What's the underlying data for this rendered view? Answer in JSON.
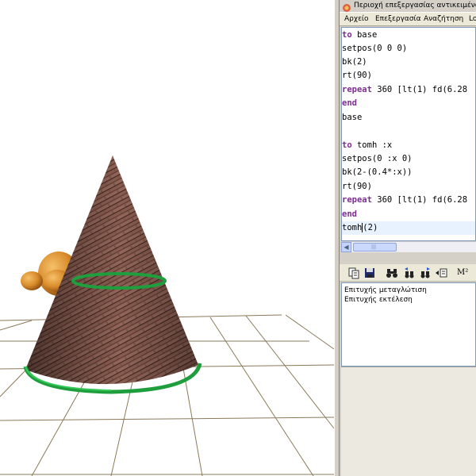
{
  "window": {
    "title": "Περιοχή επεξεργασίας αντικειμένων"
  },
  "menu": {
    "items": [
      {
        "label": "Αρχείο"
      },
      {
        "label": "Επεξεργασία"
      },
      {
        "label": "Αναζήτηση"
      },
      {
        "label": "Lo"
      }
    ]
  },
  "code": {
    "lines": [
      {
        "kw": "to",
        "text": " base"
      },
      {
        "kw": "",
        "text": "setpos(0 0 0)"
      },
      {
        "kw": "",
        "text": "bk(2)"
      },
      {
        "kw": "",
        "text": "rt(90)"
      },
      {
        "kw": "repeat",
        "text": " 360 [lt(1) fd(6.28"
      },
      {
        "kw": "end",
        "text": ""
      },
      {
        "kw": "",
        "text": "base"
      },
      {
        "kw": "",
        "text": ""
      },
      {
        "kw": "to",
        "text": " tomh :x"
      },
      {
        "kw": "",
        "text": "setpos(0 :x 0)"
      },
      {
        "kw": "",
        "text": "bk(2-(0.4*:x))"
      },
      {
        "kw": "",
        "text": "rt(90)"
      },
      {
        "kw": "repeat",
        "text": " 360 [lt(1) fd(6.28"
      },
      {
        "kw": "end",
        "text": ""
      },
      {
        "kw": "",
        "text": "tomh",
        "after_caret": "(2)"
      }
    ]
  },
  "scrollbar": {
    "left_arrow": "◀",
    "grip": "|||"
  },
  "toolbar": {
    "buttons": [
      {
        "icon": "copy-icon"
      },
      {
        "icon": "save-icon"
      },
      {
        "icon": "binoculars-icon"
      },
      {
        "icon": "find-previous-icon"
      },
      {
        "icon": "find-next-icon"
      },
      {
        "icon": "insert-list-icon"
      },
      {
        "icon": "superscript-icon",
        "label": "M²"
      }
    ]
  },
  "output": {
    "lines": [
      "Επιτυχής μεταγλώτιση",
      "Επιτυχής εκτέλεση"
    ]
  },
  "colors": {
    "keyword": "#7b2d8e",
    "ring": "#1e9e3c",
    "cone": "#7a5246",
    "grid": "#8a7a5a"
  }
}
